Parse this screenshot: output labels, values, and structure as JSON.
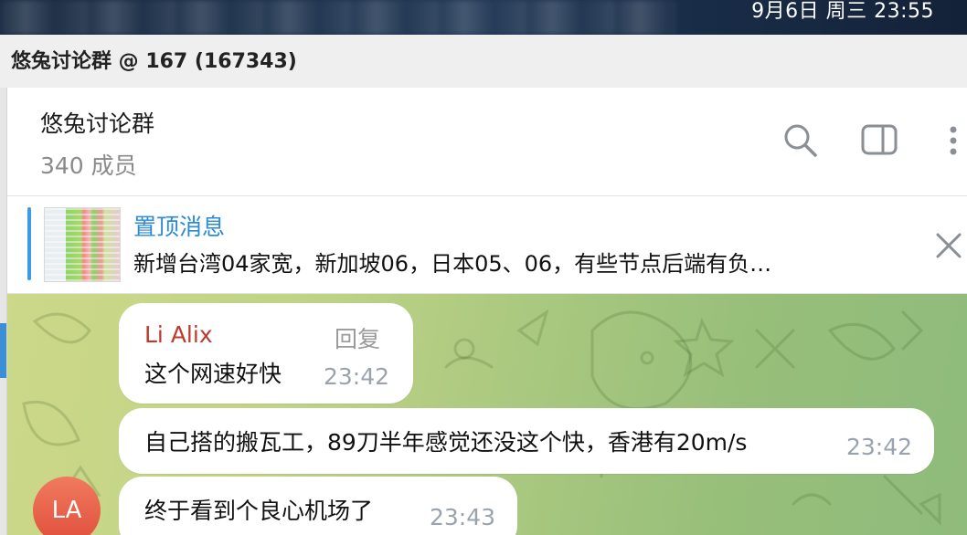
{
  "menubar": {
    "clock": "9月6日 周三 23:55"
  },
  "window": {
    "title": "悠兔讨论群 @ 167 (167343)"
  },
  "chat": {
    "name": "悠兔讨论群",
    "members": "340 成员"
  },
  "header_icons": [
    "search-icon",
    "sidebar-toggle-icon",
    "more-vertical-icon"
  ],
  "pinned": {
    "title": "置顶消息",
    "text": "新增台湾04家宽，新加坡06，日本05、06，有些节点后端有负…"
  },
  "messages": [
    {
      "sender": "Li Alix",
      "reply_label": "回复",
      "text": "这个网速好快",
      "time": "23:42"
    },
    {
      "text": "自己搭的搬瓦工，89刀半年感觉还没这个快，香港有20m/s",
      "time": "23:42"
    },
    {
      "text": "终于看到个良心机场了",
      "time": "23:43"
    }
  ],
  "avatar": {
    "initials": "LA"
  },
  "colors": {
    "accent": "#2b8ad6",
    "sender": "#c0392b",
    "avatar": "#e04f3c"
  }
}
